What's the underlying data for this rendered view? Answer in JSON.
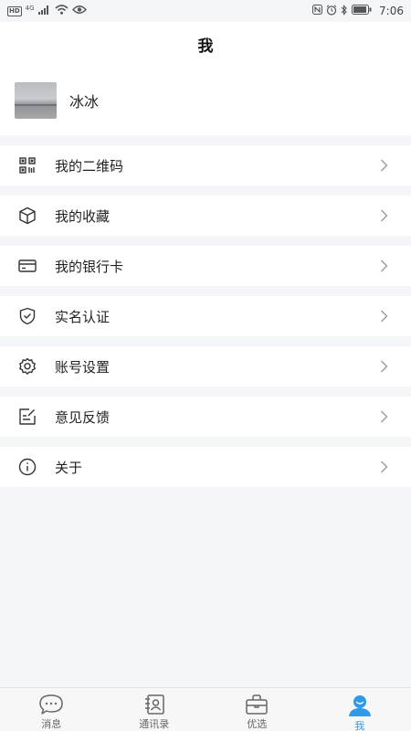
{
  "status_bar": {
    "left_badges": [
      "HD",
      "4G"
    ],
    "time": "7:06"
  },
  "header": {
    "title": "我"
  },
  "profile": {
    "name": "冰冰"
  },
  "menu": [
    {
      "label": "我的二维码",
      "icon": "qr-code-icon"
    },
    {
      "label": "我的收藏",
      "icon": "box-icon"
    },
    {
      "label": "我的银行卡",
      "icon": "bank-card-icon"
    },
    {
      "label": "实名认证",
      "icon": "shield-check-icon"
    },
    {
      "label": "账号设置",
      "icon": "gear-icon"
    },
    {
      "label": "意见反馈",
      "icon": "feedback-icon"
    },
    {
      "label": "关于",
      "icon": "info-icon"
    }
  ],
  "tabbar": {
    "tabs": [
      {
        "label": "消息",
        "icon": "chat-bubble-icon",
        "active": false
      },
      {
        "label": "通讯录",
        "icon": "contacts-icon",
        "active": false
      },
      {
        "label": "优选",
        "icon": "shopping-bag-icon",
        "active": false
      },
      {
        "label": "我",
        "icon": "user-icon",
        "active": true
      }
    ]
  },
  "colors": {
    "accent": "#2e9bea",
    "background": "#f4f5f9"
  }
}
